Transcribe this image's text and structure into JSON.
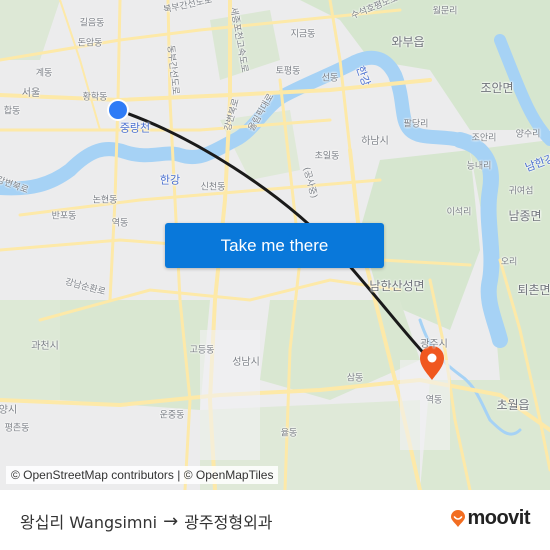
{
  "map": {
    "origin_label": "왕십리 Wangsimni",
    "destination_label": "광주정형외과",
    "colors": {
      "origin_marker": "#2f7cf6",
      "destination_marker": "#f0571f",
      "route_line": "#1a1a1a",
      "water": "#a6d2f5",
      "park": "#cfe3c2",
      "road": "#fde9a8",
      "cta": "#0978da",
      "brand_accent": "#f26d21"
    },
    "place_labels": [
      {
        "text": "길음동"
      },
      {
        "text": "돈암동"
      },
      {
        "text": "계동"
      },
      {
        "text": "서울"
      },
      {
        "text": "황학동"
      },
      {
        "text": "중랑천"
      },
      {
        "text": "합동"
      },
      {
        "text": "북부간선도로"
      },
      {
        "text": "동부간선도로"
      },
      {
        "text": "세종포천고속도로"
      },
      {
        "text": "지금동"
      },
      {
        "text": "수석호평도로"
      },
      {
        "text": "월문리"
      },
      {
        "text": "와부읍"
      },
      {
        "text": "토평동"
      },
      {
        "text": "선동"
      },
      {
        "text": "한강"
      },
      {
        "text": "조안면"
      },
      {
        "text": "팔당리"
      },
      {
        "text": "조안리"
      },
      {
        "text": "양수리"
      },
      {
        "text": "하남시"
      },
      {
        "text": "초일동"
      },
      {
        "text": "능내리"
      },
      {
        "text": "남한강"
      },
      {
        "text": "귀여섬"
      },
      {
        "text": "이석리"
      },
      {
        "text": "남종면"
      },
      {
        "text": "오리"
      },
      {
        "text": "퇴촌면"
      },
      {
        "text": "한강"
      },
      {
        "text": "신천동"
      },
      {
        "text": "논현동"
      },
      {
        "text": "반포동"
      },
      {
        "text": "역동"
      },
      {
        "text": "강변북로"
      },
      {
        "text": "강남순환로"
      },
      {
        "text": "남한산성면"
      },
      {
        "text": "과천시"
      },
      {
        "text": "고등동"
      },
      {
        "text": "성남시"
      },
      {
        "text": "광주시"
      },
      {
        "text": "삼동"
      },
      {
        "text": "역동"
      },
      {
        "text": "초월읍"
      },
      {
        "text": "운중동"
      },
      {
        "text": "율동"
      },
      {
        "text": "평촌동"
      },
      {
        "text": "양시"
      },
      {
        "text": "강변북로"
      },
      {
        "text": "올림픽대로"
      },
      {
        "text": "(공사중)"
      }
    ]
  },
  "cta": {
    "label": "Take me there"
  },
  "attribution": "© OpenStreetMap contributors | © OpenMapTiles",
  "footer": {
    "origin": "왕십리 Wangsimni",
    "arrow": "→",
    "destination": "광주정형외과",
    "brand": "moovit"
  }
}
